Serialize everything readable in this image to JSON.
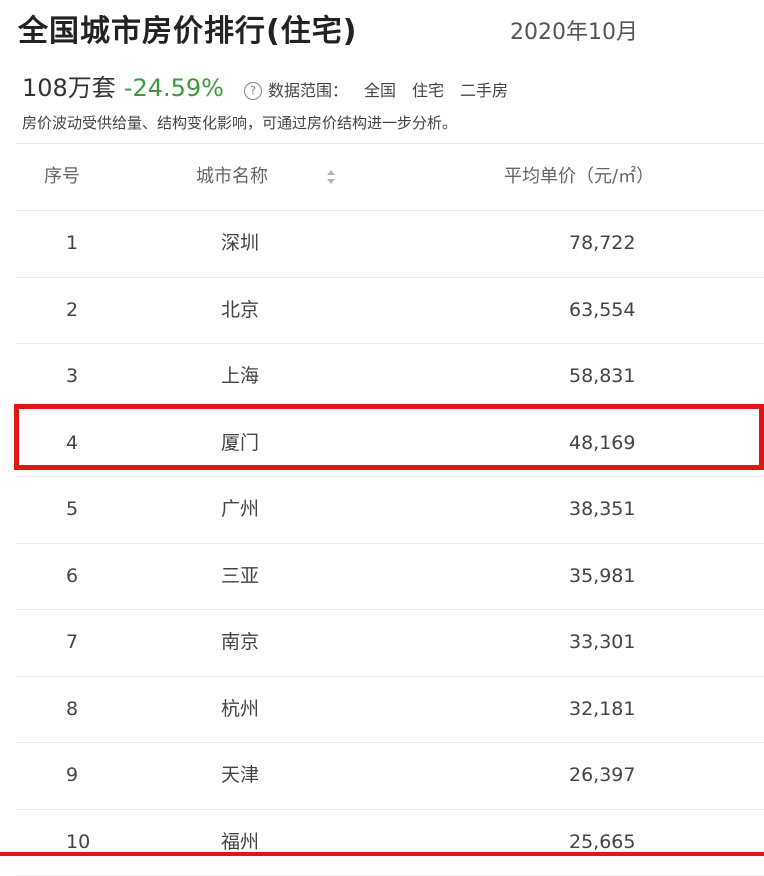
{
  "header": {
    "title": "全国城市房价排行(住宅)",
    "date": "2020年10月",
    "count": "108万套",
    "change": "-24.59%",
    "help_icon": "?",
    "scope_label": "数据范围：",
    "scope_items": [
      "全国",
      "住宅",
      "二手房"
    ],
    "note": "房价波动受供给量、结构变化影响，可通过房价结构进一步分析。"
  },
  "table": {
    "headers": {
      "no": "序号",
      "city": "城市名称",
      "price": "平均单价（元/㎡）"
    },
    "rows": [
      {
        "no": "1",
        "city": "深圳",
        "price": "78,722"
      },
      {
        "no": "2",
        "city": "北京",
        "price": "63,554"
      },
      {
        "no": "3",
        "city": "上海",
        "price": "58,831"
      },
      {
        "no": "4",
        "city": "厦门",
        "price": "48,169"
      },
      {
        "no": "5",
        "city": "广州",
        "price": "38,351"
      },
      {
        "no": "6",
        "city": "三亚",
        "price": "35,981"
      },
      {
        "no": "7",
        "city": "南京",
        "price": "33,301"
      },
      {
        "no": "8",
        "city": "杭州",
        "price": "32,181"
      },
      {
        "no": "9",
        "city": "天津",
        "price": "26,397"
      },
      {
        "no": "10",
        "city": "福州",
        "price": "25,665"
      }
    ]
  },
  "colors": {
    "positive_change": "#3f9a3f",
    "highlight": "#e01515"
  },
  "icons": {
    "help": "question-circle-icon",
    "sort": "sort-arrows-icon"
  }
}
